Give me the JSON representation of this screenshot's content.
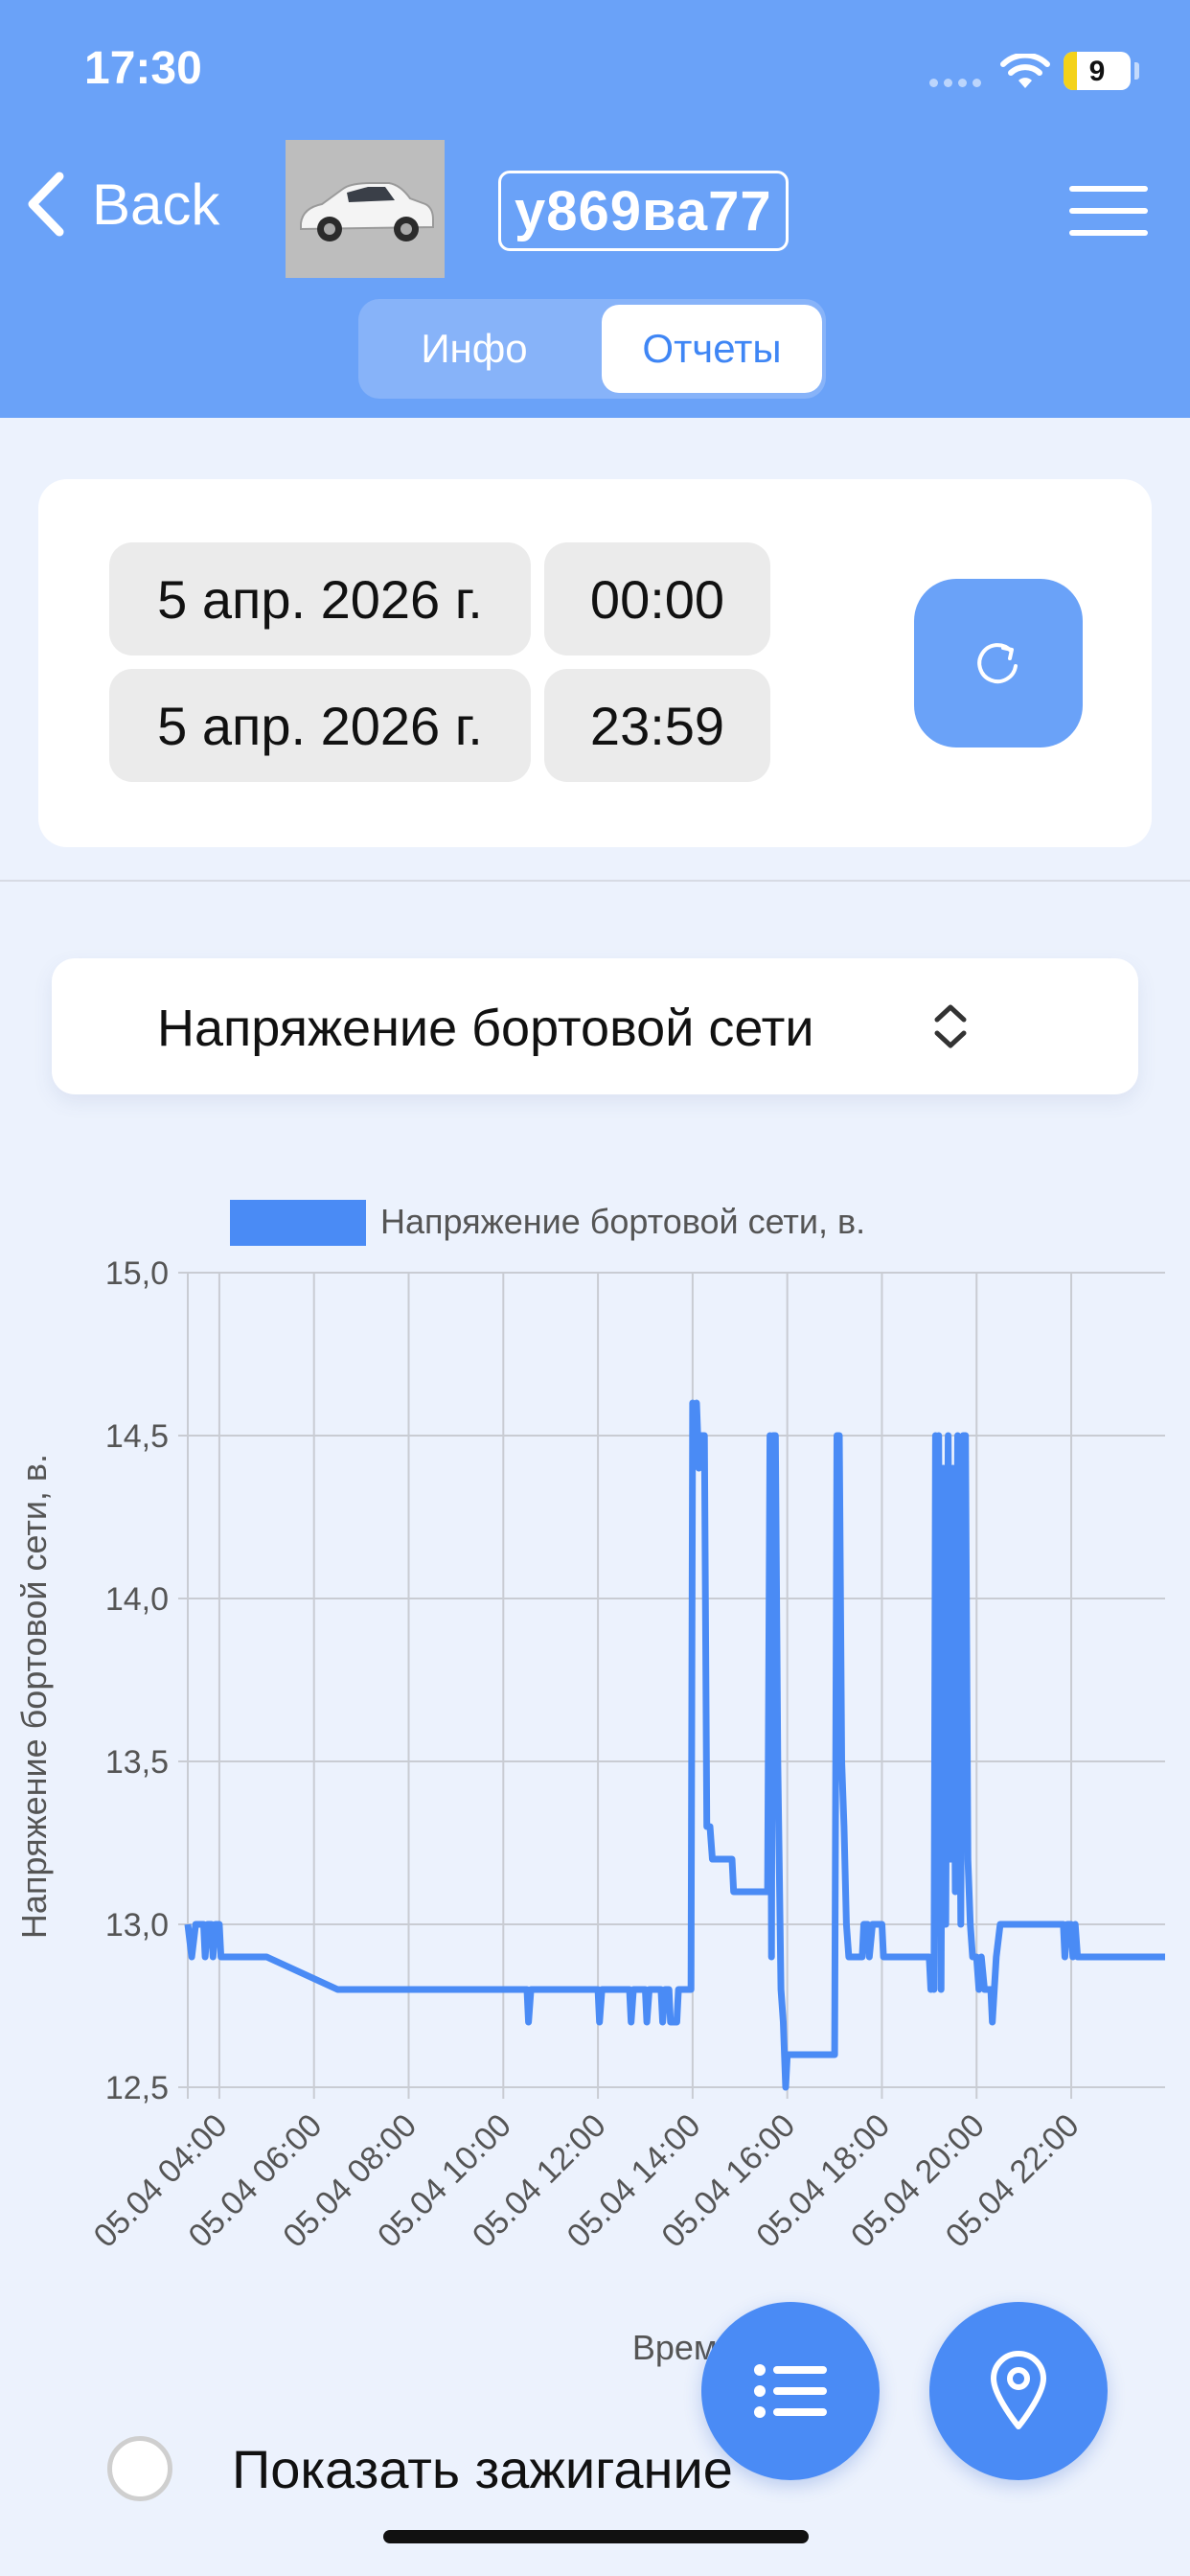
{
  "status_bar": {
    "time": "17:30",
    "battery": "9"
  },
  "header": {
    "back_label": "Back",
    "plate": "у869ва77",
    "tabs": [
      {
        "label": "Инфо",
        "selected": false
      },
      {
        "label": "Отчеты",
        "selected": true
      }
    ]
  },
  "period": {
    "start_date": "5 апр. 2026 г.",
    "start_time": "00:00",
    "end_date": "5 апр. 2026 г.",
    "end_time": "23:59"
  },
  "report_selector": {
    "value": "Напряжение бортовой сети"
  },
  "chart_data": {
    "type": "line",
    "legend": "Напряжение бортовой сети, в.",
    "ylabel": "Напряжение бортовой сети, в.",
    "xlabel": "Время",
    "ylim": [
      12.5,
      15.0
    ],
    "y_ticks": [
      "15,0",
      "14,5",
      "14,0",
      "13,5",
      "13,0",
      "12,5"
    ],
    "x_ticks": [
      "05.04 04:00",
      "05.04 06:00",
      "05.04 08:00",
      "05.04 10:00",
      "05.04 12:00",
      "05.04 14:00",
      "05.04 16:00",
      "05.04 18:00",
      "05.04 20:00",
      "05.04 22:00"
    ],
    "grid": true,
    "legend_position": "top",
    "color": "#4a8bf5",
    "series": [
      {
        "name": "Напряжение бортовой сети, в.",
        "points": [
          [
            "03:20",
            13.0
          ],
          [
            "03:25",
            12.9
          ],
          [
            "03:30",
            13.0
          ],
          [
            "03:40",
            13.0
          ],
          [
            "03:42",
            12.9
          ],
          [
            "03:45",
            13.0
          ],
          [
            "03:50",
            13.0
          ],
          [
            "03:52",
            12.9
          ],
          [
            "03:55",
            13.0
          ],
          [
            "04:00",
            13.0
          ],
          [
            "04:02",
            12.9
          ],
          [
            "05:00",
            12.9
          ],
          [
            "06:30",
            12.8
          ],
          [
            "10:30",
            12.8
          ],
          [
            "10:32",
            12.7
          ],
          [
            "10:35",
            12.8
          ],
          [
            "12:00",
            12.8
          ],
          [
            "12:02",
            12.7
          ],
          [
            "12:05",
            12.8
          ],
          [
            "12:40",
            12.8
          ],
          [
            "12:42",
            12.7
          ],
          [
            "12:45",
            12.8
          ],
          [
            "13:00",
            12.8
          ],
          [
            "13:02",
            12.7
          ],
          [
            "13:05",
            12.8
          ],
          [
            "13:20",
            12.8
          ],
          [
            "13:22",
            12.7
          ],
          [
            "13:25",
            12.8
          ],
          [
            "13:30",
            12.8
          ],
          [
            "13:32",
            12.7
          ],
          [
            "13:40",
            12.7
          ],
          [
            "13:42",
            12.8
          ],
          [
            "13:58",
            12.8
          ],
          [
            "14:00",
            14.6
          ],
          [
            "14:02",
            14.5
          ],
          [
            "14:05",
            14.6
          ],
          [
            "14:08",
            14.4
          ],
          [
            "14:10",
            14.5
          ],
          [
            "14:15",
            14.5
          ],
          [
            "14:18",
            13.3
          ],
          [
            "14:22",
            13.3
          ],
          [
            "14:25",
            13.2
          ],
          [
            "14:50",
            13.2
          ],
          [
            "14:52",
            13.1
          ],
          [
            "15:35",
            13.1
          ],
          [
            "15:38",
            14.5
          ],
          [
            "15:40",
            12.9
          ],
          [
            "15:42",
            14.5
          ],
          [
            "15:45",
            14.5
          ],
          [
            "15:48",
            13.5
          ],
          [
            "15:52",
            12.8
          ],
          [
            "15:55",
            12.7
          ],
          [
            "15:58",
            12.5
          ],
          [
            "16:00",
            12.6
          ],
          [
            "17:00",
            12.6
          ],
          [
            "17:03",
            14.5
          ],
          [
            "17:06",
            14.5
          ],
          [
            "17:09",
            13.5
          ],
          [
            "17:12",
            13.3
          ],
          [
            "17:15",
            13.0
          ],
          [
            "17:18",
            12.9
          ],
          [
            "17:35",
            12.9
          ],
          [
            "17:37",
            13.0
          ],
          [
            "17:42",
            13.0
          ],
          [
            "17:44",
            12.9
          ],
          [
            "17:48",
            13.0
          ],
          [
            "18:00",
            13.0
          ],
          [
            "18:02",
            12.9
          ],
          [
            "19:00",
            12.9
          ],
          [
            "19:02",
            12.8
          ],
          [
            "19:04",
            12.9
          ],
          [
            "19:06",
            12.8
          ],
          [
            "19:08",
            14.5
          ],
          [
            "19:10",
            13.0
          ],
          [
            "19:12",
            14.5
          ],
          [
            "19:15",
            12.8
          ],
          [
            "19:18",
            14.4
          ],
          [
            "19:21",
            13.0
          ],
          [
            "19:24",
            14.5
          ],
          [
            "19:27",
            13.2
          ],
          [
            "19:30",
            14.4
          ],
          [
            "19:33",
            13.1
          ],
          [
            "19:36",
            14.5
          ],
          [
            "19:40",
            13.0
          ],
          [
            "19:43",
            14.5
          ],
          [
            "19:46",
            14.5
          ],
          [
            "19:49",
            13.2
          ],
          [
            "19:52",
            13.0
          ],
          [
            "19:55",
            12.9
          ],
          [
            "20:00",
            12.9
          ],
          [
            "20:03",
            12.8
          ],
          [
            "20:06",
            12.9
          ],
          [
            "20:10",
            12.8
          ],
          [
            "20:18",
            12.8
          ],
          [
            "20:20",
            12.7
          ],
          [
            "20:25",
            12.9
          ],
          [
            "20:30",
            13.0
          ],
          [
            "21:50",
            13.0
          ],
          [
            "21:52",
            12.9
          ],
          [
            "21:55",
            13.0
          ],
          [
            "22:00",
            13.0
          ],
          [
            "22:02",
            12.9
          ],
          [
            "22:05",
            13.0
          ],
          [
            "22:08",
            12.9
          ],
          [
            "23:59",
            12.9
          ]
        ]
      }
    ]
  },
  "ignition_toggle": {
    "label": "Показать зажигание",
    "checked": false
  },
  "fabs": {
    "list_icon": "list-icon",
    "map_icon": "map-pin-icon"
  }
}
